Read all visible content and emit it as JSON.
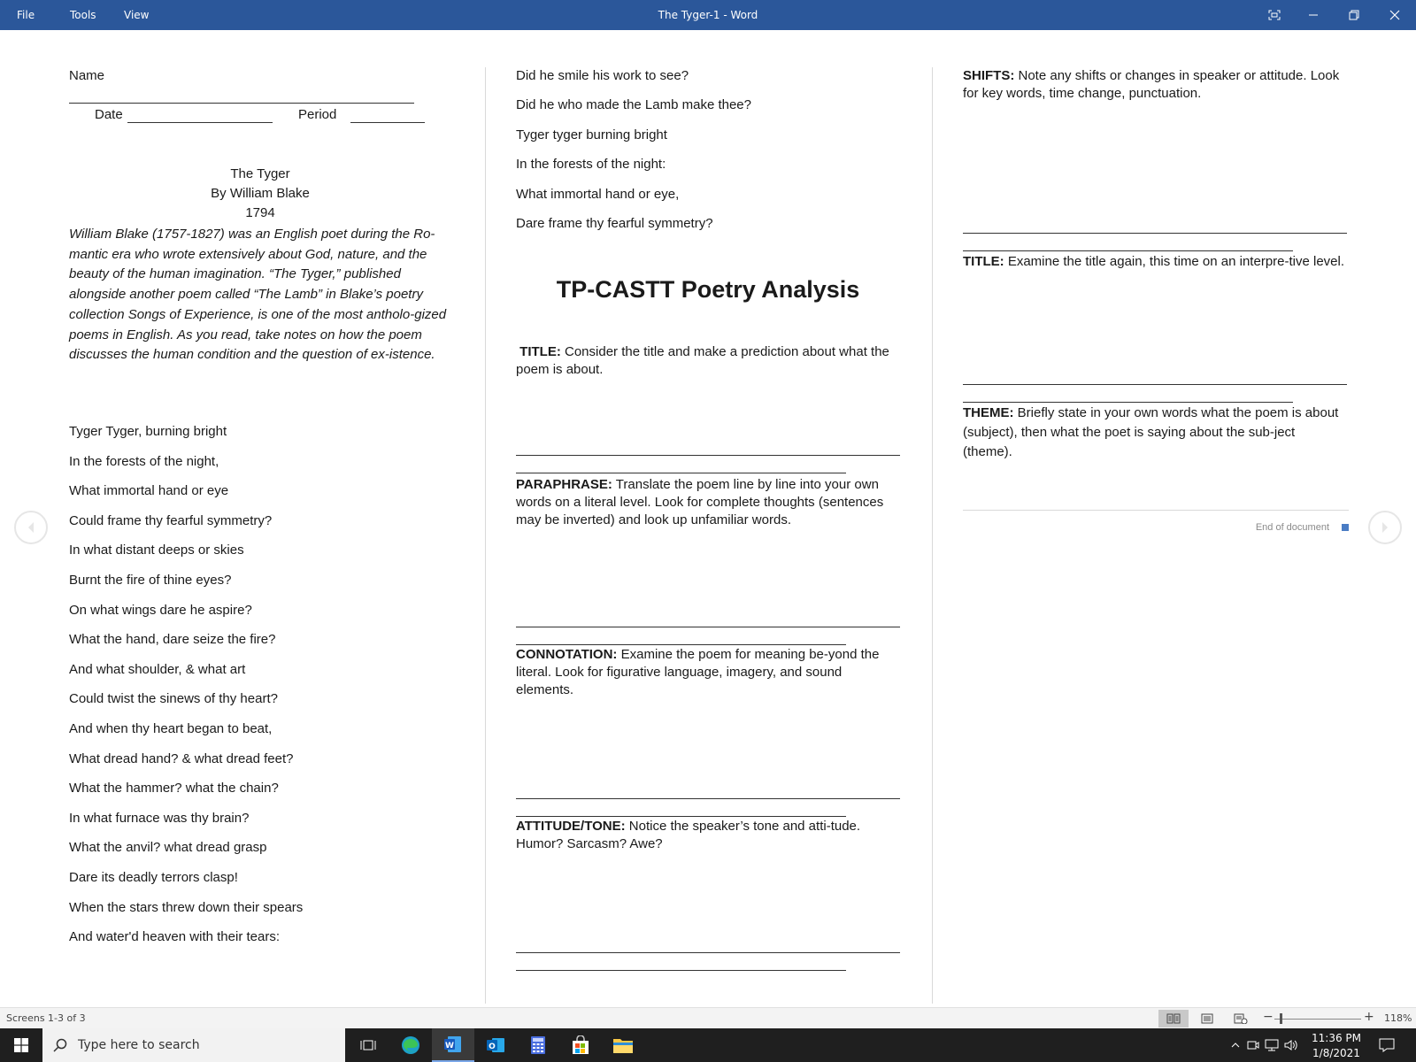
{
  "window": {
    "title": "The Tyger-1 - Word",
    "menu": [
      "File",
      "Tools",
      "View"
    ]
  },
  "page1": {
    "name_label": "Name",
    "date_label": "Date",
    "period_label": "Period",
    "poem_title": "The Tyger",
    "author": "By William Blake",
    "year": "1794",
    "intro": "William Blake (1757-1827) was an English poet during the Ro-mantic era who wrote extensively about God, nature, and the beauty of the human imagination. “The Tyger,” published alongside another poem called “The Lamb” in Blake’s poetry collection Songs of Experience, is one of the most antholo-gized poems in English. As you read, take notes on how the poem discusses the human condition and the question of ex-istence.",
    "poem_lines": [
      "Tyger Tyger, burning bright",
      "In the forests of the night,",
      "What immortal hand or eye",
      "Could frame thy fearful symmetry?",
      "In what distant deeps or skies",
      "Burnt the fire of thine eyes?",
      "On what wings dare he aspire?",
      "What the hand, dare seize the fire?",
      "And what shoulder, & what art",
      "Could twist the sinews of thy heart?",
      "And when thy heart began to beat,",
      "What dread hand? & what dread feet?",
      "What the hammer? what the chain?",
      "In what furnace was thy brain?",
      "What the anvil? what dread grasp",
      "Dare its deadly terrors clasp!",
      "When the stars threw down their spears",
      "And water'd heaven with their tears:"
    ]
  },
  "page2": {
    "poem_lines": [
      "Did he smile his work to see?",
      "Did he who made the Lamb make thee?",
      "Tyger tyger burning bright",
      "In the forests of the night:",
      "What immortal hand or eye,",
      "Dare frame thy fearful symmetry?"
    ],
    "heading": "TP-CASTT Poetry Analysis",
    "sections": [
      {
        "label": "TITLE:",
        "text": " Consider the title and make a prediction about what the poem is about."
      },
      {
        "label": "PARAPHRASE:",
        "text": " Translate the poem line by line into your own words on a literal level. Look for complete thoughts (sentences may be inverted) and look up unfamiliar words."
      },
      {
        "label": "CONNOTATION:",
        "text": " Examine the poem for meaning be-yond the literal. Look for figurative language, imagery, and sound elements."
      },
      {
        "label": "ATTITUDE/TONE:",
        "text": " Notice the speaker’s tone and atti-tude. Humor? Sarcasm? Awe?"
      }
    ]
  },
  "page3": {
    "sections": [
      {
        "label": "SHIFTS:",
        "text": " Note any shifts or changes in speaker or attitude. Look for key words, time change, punctuation."
      },
      {
        "label": "TITLE:",
        "text": " Examine the title again, this time on an interpre-tive level."
      },
      {
        "label": "THEME:",
        "text": " Briefly state in your own words what the poem is about (subject), then what the poet is saying about the sub-ject (theme)."
      }
    ],
    "end_label": "End of document"
  },
  "status": {
    "screens": "Screens 1-3 of 3",
    "zoom": "118%"
  },
  "taskbar": {
    "search_placeholder": "Type here to search",
    "time": "11:36 PM",
    "date": "1/8/2021"
  },
  "colors": {
    "titlebar": "#2b579a",
    "taskbar": "#1f1f1f",
    "end_marker": "#4a7cc4"
  }
}
